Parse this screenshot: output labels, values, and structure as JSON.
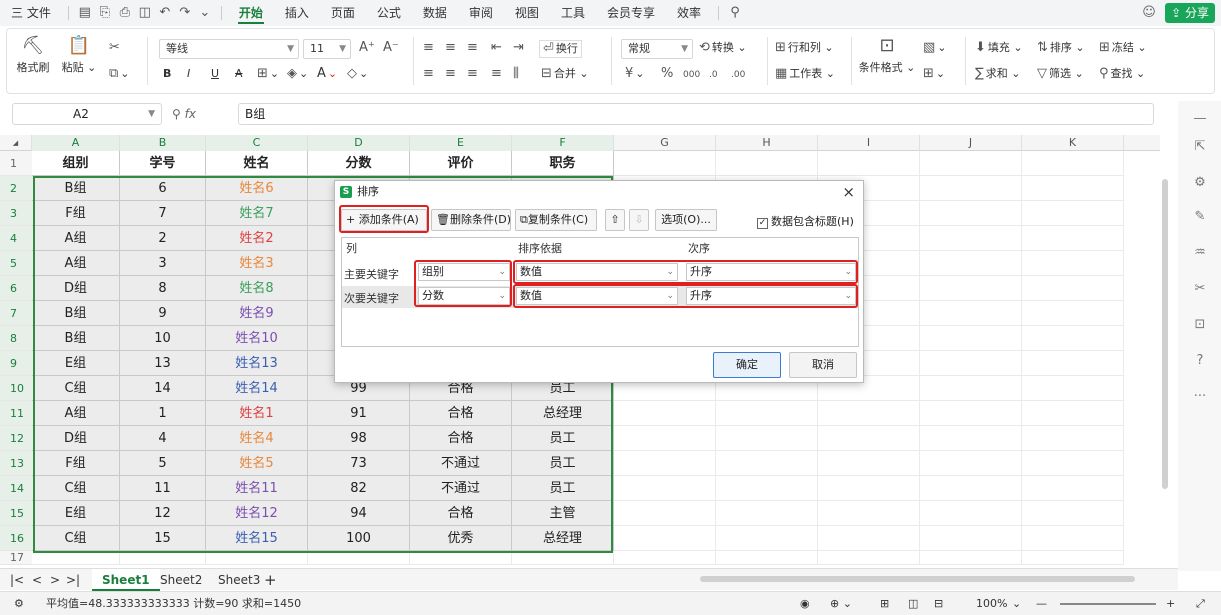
{
  "menu": {
    "file": "三 文件",
    "tabs": [
      "开始",
      "插入",
      "页面",
      "公式",
      "数据",
      "审阅",
      "视图",
      "工具",
      "会员专享",
      "效率"
    ],
    "active": "开始",
    "share": "分享"
  },
  "ribbon": {
    "format_painter": "格式刷",
    "paste": "粘贴",
    "font_name": "等线",
    "font_size": "11",
    "bold": "B",
    "italic": "I",
    "underline": "U",
    "strike": "A",
    "wrap": "换行",
    "merge": "合并",
    "number_format": "常规",
    "convert": "转换",
    "row_col": "行和列",
    "worksheet": "工作表",
    "cond_format": "条件格式",
    "fill": "填充",
    "sort": "排序",
    "freeze": "冻结",
    "sum": "求和",
    "filter": "筛选",
    "find": "查找"
  },
  "formula_bar": {
    "cell_ref": "A2",
    "fx": "fx",
    "content": "B组"
  },
  "columns": [
    "A",
    "B",
    "C",
    "D",
    "E",
    "F",
    "G",
    "H",
    "I",
    "J",
    "K"
  ],
  "table": {
    "headers": [
      "组别",
      "学号",
      "姓名",
      "分数",
      "评价",
      "职务"
    ],
    "rows": [
      [
        "B组",
        "6",
        "姓名6",
        "",
        "",
        ""
      ],
      [
        "F组",
        "7",
        "姓名7",
        "",
        "",
        ""
      ],
      [
        "A组",
        "2",
        "姓名2",
        "",
        "",
        ""
      ],
      [
        "A组",
        "3",
        "姓名3",
        "",
        "",
        ""
      ],
      [
        "D组",
        "8",
        "姓名8",
        "",
        "",
        ""
      ],
      [
        "B组",
        "9",
        "姓名9",
        "",
        "",
        ""
      ],
      [
        "B组",
        "10",
        "姓名10",
        "",
        "",
        ""
      ],
      [
        "E组",
        "13",
        "姓名13",
        "",
        "",
        ""
      ],
      [
        "C组",
        "14",
        "姓名14",
        "99",
        "合格",
        "员工"
      ],
      [
        "A组",
        "1",
        "姓名1",
        "91",
        "合格",
        "总经理"
      ],
      [
        "D组",
        "4",
        "姓名4",
        "98",
        "合格",
        "员工"
      ],
      [
        "F组",
        "5",
        "姓名5",
        "73",
        "不通过",
        "员工"
      ],
      [
        "C组",
        "11",
        "姓名11",
        "82",
        "不通过",
        "员工"
      ],
      [
        "E组",
        "12",
        "姓名12",
        "94",
        "合格",
        "主管"
      ],
      [
        "C组",
        "15",
        "姓名15",
        "100",
        "优秀",
        "总经理"
      ]
    ],
    "name_colors": [
      "#e8873a",
      "#3aa05a",
      "#e04040",
      "#e8873a",
      "#3aa05a",
      "#7a4fb0",
      "#7a4fb0",
      "#3a5fb0",
      "#3a5fb0",
      "#e04040",
      "#e8873a",
      "#e8873a",
      "#7a4fb0",
      "#7a4fb0",
      "#3a5fb0"
    ]
  },
  "dialog": {
    "title": "排序",
    "logo": "S",
    "add": "+ 添加条件(A)",
    "delete": "删除条件(D)",
    "copy": "复制条件(C)",
    "options": "选项(O)...",
    "has_header": "数据包含标题(H)",
    "col_headers": [
      "列",
      "排序依据",
      "次序"
    ],
    "primary": {
      "label": "主要关键字",
      "column": "组别",
      "basis": "数值",
      "order": "升序"
    },
    "secondary": {
      "label": "次要关键字",
      "column": "分数",
      "basis": "数值",
      "order": "升序"
    },
    "ok": "确定",
    "cancel": "取消"
  },
  "sheets": [
    "Sheet1",
    "Sheet2",
    "Sheet3"
  ],
  "active_sheet": "Sheet1",
  "status": {
    "text": "平均值=48.333333333333 计数=90 求和=1450",
    "zoom": "100%"
  }
}
